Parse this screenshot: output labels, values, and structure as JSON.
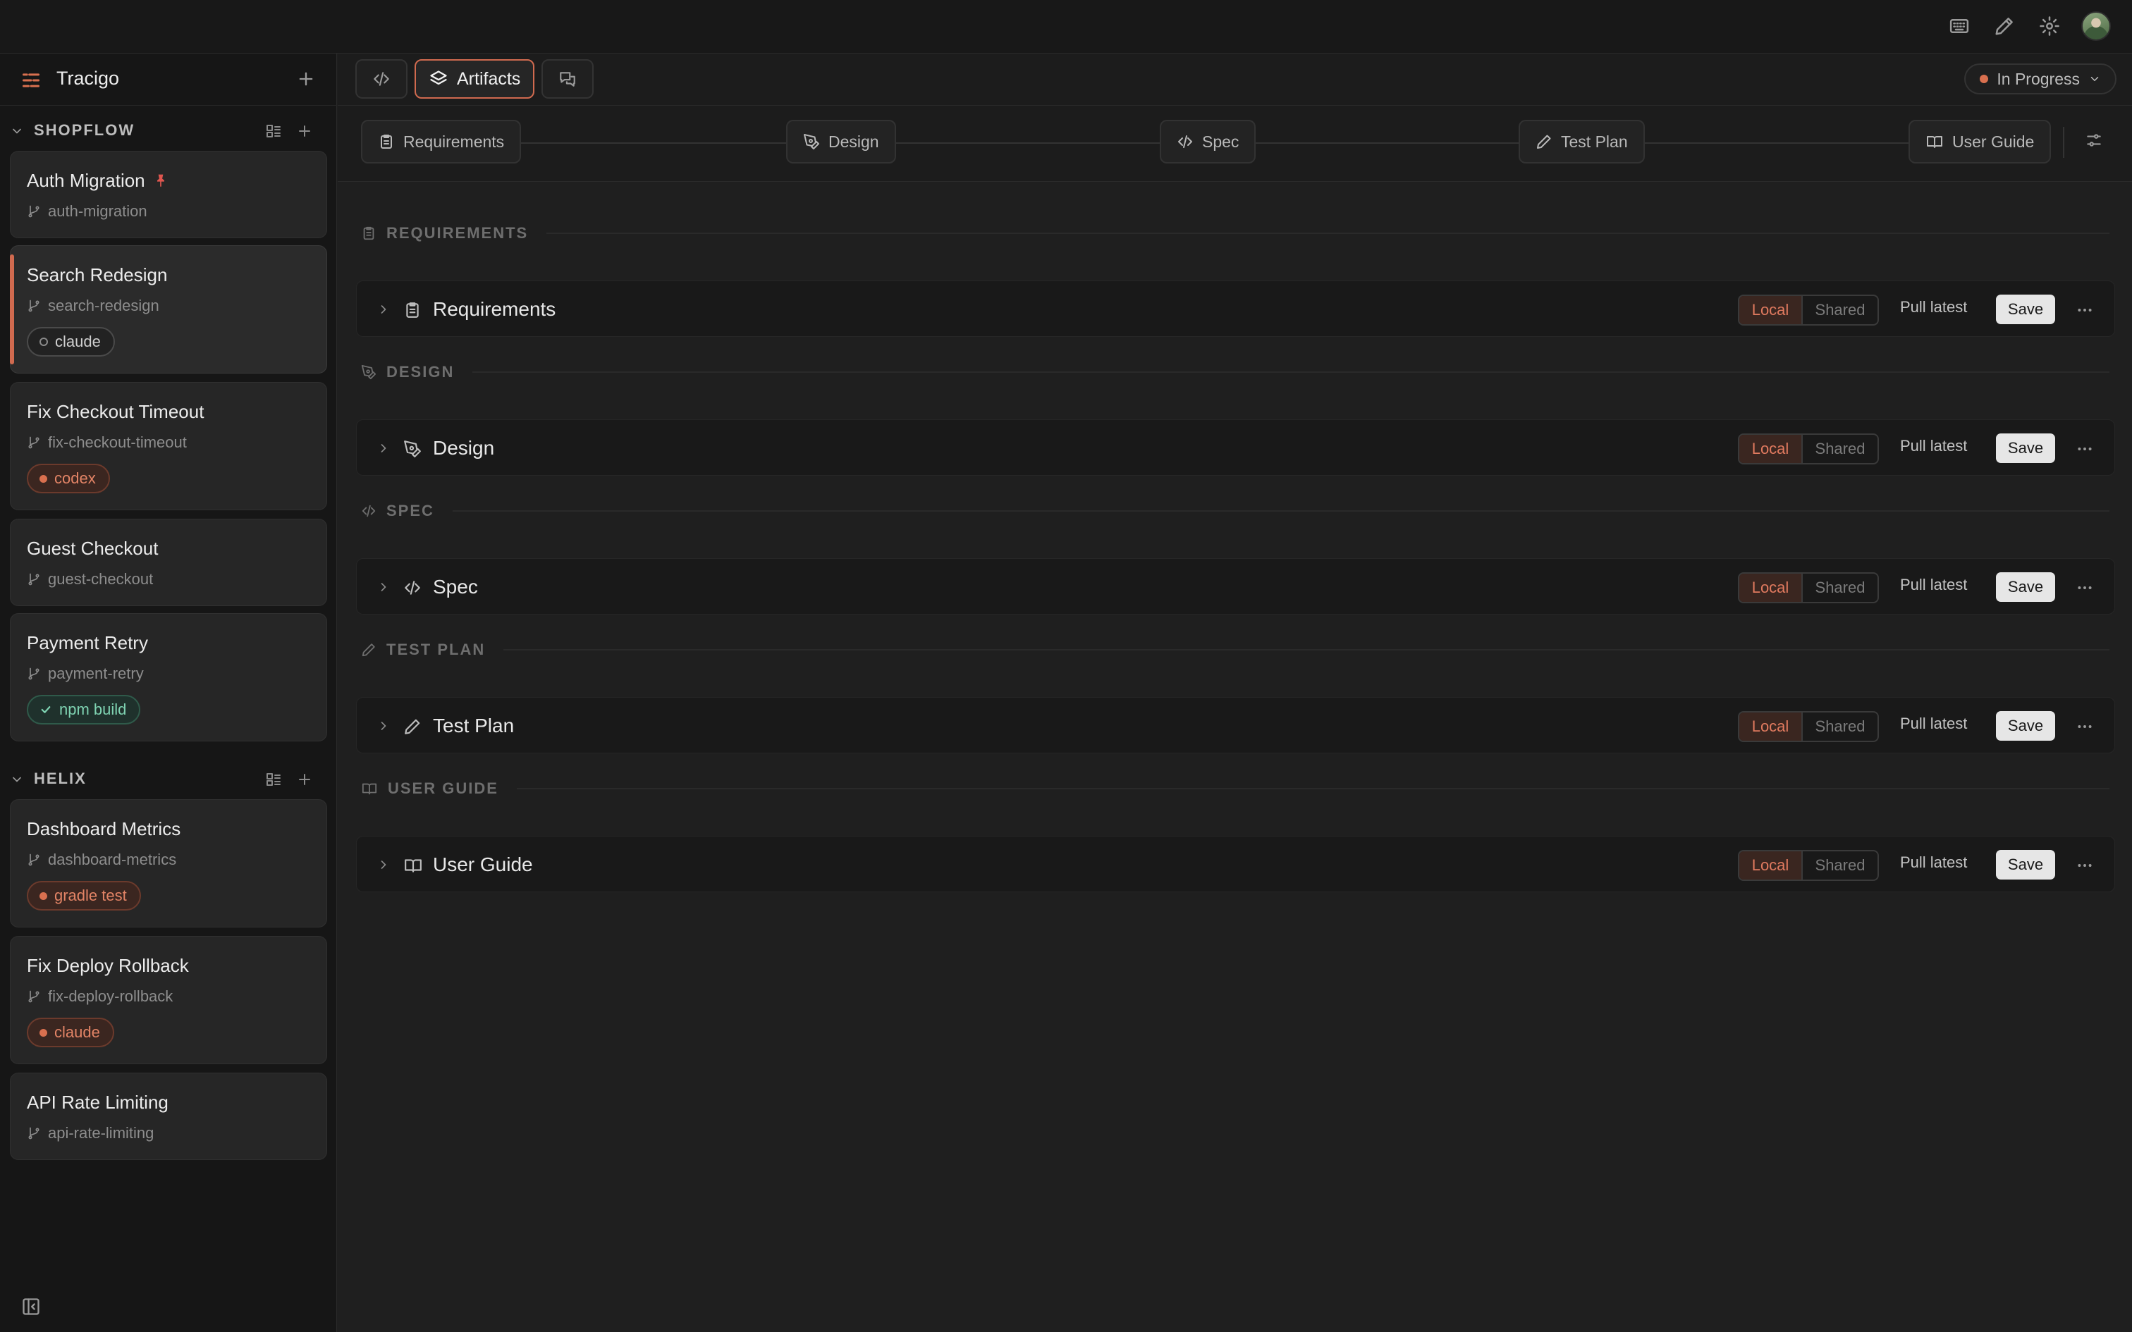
{
  "app": {
    "name": "Tracigo"
  },
  "topbar": {
    "icons": [
      "keyboard-icon",
      "pen-icon",
      "gear-icon",
      "avatar"
    ]
  },
  "sidebar": {
    "groups": [
      {
        "name": "SHOPFLOW",
        "items": [
          {
            "title": "Auth Migration",
            "branch": "auth-migration",
            "pinned": true
          },
          {
            "title": "Search Redesign",
            "branch": "search-redesign",
            "badge": "claude",
            "active": true
          },
          {
            "title": "Fix Checkout Timeout",
            "branch": "fix-checkout-timeout",
            "badge": "codex"
          },
          {
            "title": "Guest Checkout",
            "branch": "guest-checkout"
          },
          {
            "title": "Payment Retry",
            "branch": "payment-retry",
            "badge": "npm build"
          }
        ]
      },
      {
        "name": "HELIX",
        "items": [
          {
            "title": "Dashboard Metrics",
            "branch": "dashboard-metrics",
            "badge": "gradle test"
          },
          {
            "title": "Fix Deploy Rollback",
            "branch": "fix-deploy-rollback",
            "badge": "claude"
          },
          {
            "title": "API Rate Limiting",
            "branch": "api-rate-limiting"
          }
        ]
      }
    ]
  },
  "header": {
    "tabs": {
      "artifacts": "Artifacts"
    },
    "status": "In Progress"
  },
  "steps": [
    "Requirements",
    "Design",
    "Spec",
    "Test Plan",
    "User Guide"
  ],
  "sections": [
    {
      "heading": "REQUIREMENTS",
      "title": "Requirements",
      "icon": "clipboard-icon"
    },
    {
      "heading": "DESIGN",
      "title": "Design",
      "icon": "pen-tool-icon"
    },
    {
      "heading": "SPEC",
      "title": "Spec",
      "icon": "code-icon"
    },
    {
      "heading": "TEST PLAN",
      "title": "Test Plan",
      "icon": "pencil-icon"
    },
    {
      "heading": "USER GUIDE",
      "title": "User Guide",
      "icon": "book-icon"
    }
  ],
  "row_actions": {
    "local": "Local",
    "shared": "Shared",
    "pull": "Pull latest",
    "save": "Save"
  },
  "colors": {
    "accent": "#d9704f",
    "success": "#7fd3b2"
  }
}
